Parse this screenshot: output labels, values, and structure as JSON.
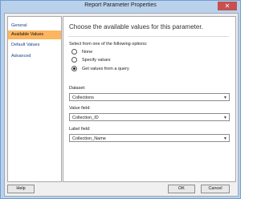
{
  "window": {
    "title": "Report Parameter Properties",
    "close": "✕"
  },
  "sidebar": {
    "items": [
      {
        "label": "General"
      },
      {
        "label": "Available Values"
      },
      {
        "label": "Default Values"
      },
      {
        "label": "Advanced"
      }
    ]
  },
  "main": {
    "heading": "Choose the available values for this parameter.",
    "prompt": "Select from one of the following options:",
    "options": [
      {
        "label": "None",
        "selected": false
      },
      {
        "label": "Specify values",
        "selected": false
      },
      {
        "label": "Get values from a query",
        "selected": true
      }
    ],
    "dataset": {
      "label": "Dataset:",
      "value": "Collections"
    },
    "value_field": {
      "label": "Value field:",
      "value": "Collection_ID"
    },
    "label_field": {
      "label": "Label field:",
      "value": "Collection_Name"
    }
  },
  "footer": {
    "help": "Help",
    "ok": "OK",
    "cancel": "Cancel"
  },
  "colors": {
    "active_nav": "#fdb55f",
    "window_frame": "#b9d1ea",
    "close": "#c75050"
  }
}
